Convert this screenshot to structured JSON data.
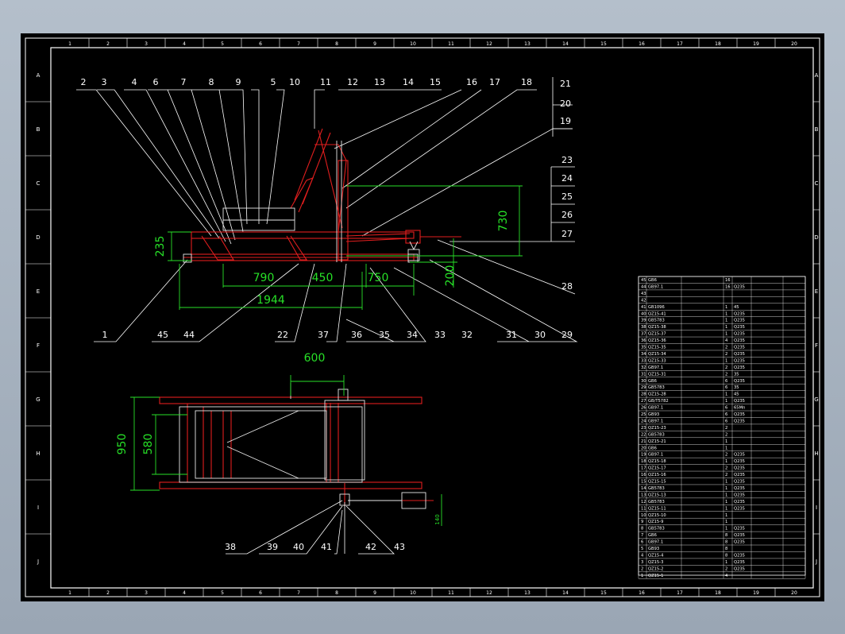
{
  "window": {
    "background_colors": [
      "#b4bfcb",
      "#9aa6b4"
    ],
    "canvas_color": "#000000"
  },
  "frame": {
    "columns": [
      "1",
      "2",
      "3",
      "4",
      "5",
      "6",
      "7",
      "8",
      "9",
      "10",
      "11",
      "12",
      "13",
      "14",
      "15",
      "16",
      "17",
      "18",
      "19",
      "20"
    ],
    "rows": [
      "A",
      "B",
      "C",
      "D",
      "E",
      "F",
      "G",
      "H",
      "I",
      "J"
    ],
    "line_color": "#ffffff"
  },
  "side_view": {
    "callouts_top": [
      "2",
      "3",
      "4",
      "6",
      "7",
      "8",
      "9",
      "5",
      "10",
      "11",
      "12",
      "13",
      "14",
      "15",
      "16",
      "17",
      "18",
      "21",
      "20",
      "19"
    ],
    "callouts_right": [
      "23",
      "24",
      "25",
      "26",
      "27",
      "28"
    ],
    "callouts_bottom": [
      "1",
      "45",
      "44",
      "22",
      "37",
      "36",
      "35",
      "34",
      "33",
      "32",
      "31",
      "30",
      "29"
    ],
    "dimensions": [
      "235",
      "790",
      "450",
      "750",
      "1944",
      "730",
      "200"
    ]
  },
  "top_view": {
    "dimensions": [
      "600",
      "950",
      "580",
      "140"
    ],
    "callouts": [
      "38",
      "39",
      "40",
      "41",
      "42",
      "43"
    ]
  },
  "parts_list": {
    "rows": [
      [
        "45",
        "GB6",
        "",
        "16",
        ""
      ],
      [
        "44",
        "GB97.1",
        "",
        "16",
        "Q235"
      ],
      [
        "43",
        "",
        "",
        "",
        ""
      ],
      [
        "42",
        "",
        "",
        "",
        ""
      ],
      [
        "41",
        "GB1096",
        "",
        "1",
        "45"
      ],
      [
        "40",
        "QZ15-41",
        "",
        "1",
        "Q235"
      ],
      [
        "39",
        "GB5783",
        "",
        "1",
        "Q235"
      ],
      [
        "38",
        "QZ15-38",
        "",
        "1",
        "Q235"
      ],
      [
        "37",
        "QZ15-37",
        "",
        "1",
        "Q235"
      ],
      [
        "36",
        "QZ15-36",
        "",
        "4",
        "Q235"
      ],
      [
        "35",
        "QZ15-35",
        "",
        "2",
        "Q235"
      ],
      [
        "34",
        "QZ15-34",
        "",
        "2",
        "Q235"
      ],
      [
        "33",
        "QZ15-33",
        "",
        "1",
        "Q235"
      ],
      [
        "32",
        "GB97.1",
        "",
        "2",
        "Q235"
      ],
      [
        "31",
        "QZ15-31",
        "",
        "2",
        "35"
      ],
      [
        "30",
        "GB6",
        "",
        "6",
        "Q235"
      ],
      [
        "29",
        "GB5783",
        "",
        "6",
        "35"
      ],
      [
        "28",
        "QZ15-28",
        "",
        "1",
        "45"
      ],
      [
        "27",
        "GB/T5782",
        "",
        "1",
        "Q235"
      ],
      [
        "26",
        "GB97.1",
        "",
        "6",
        "65Mn"
      ],
      [
        "25",
        "GB93",
        "",
        "6",
        "Q235"
      ],
      [
        "24",
        "GB97.1",
        "",
        "6",
        "Q235"
      ],
      [
        "23",
        "QZ15-23",
        "",
        "2",
        ""
      ],
      [
        "22",
        "GB5783",
        "",
        "2",
        ""
      ],
      [
        "21",
        "QZ15-21",
        "",
        "1",
        ""
      ],
      [
        "20",
        "GB6",
        "",
        "1",
        ""
      ],
      [
        "19",
        "GB97.1",
        "",
        "2",
        "Q235"
      ],
      [
        "18",
        "QZ15-18",
        "",
        "1",
        "Q235"
      ],
      [
        "17",
        "QZ15-17",
        "",
        "2",
        "Q235"
      ],
      [
        "16",
        "QZ15-16",
        "",
        "2",
        "Q235"
      ],
      [
        "15",
        "QZ15-15",
        "",
        "1",
        "Q235"
      ],
      [
        "14",
        "GB5783",
        "",
        "1",
        "Q235"
      ],
      [
        "13",
        "QZ15-13",
        "",
        "1",
        "Q235"
      ],
      [
        "12",
        "GB5783",
        "",
        "1",
        "Q235"
      ],
      [
        "11",
        "QZ15-11",
        "",
        "1",
        "Q235"
      ],
      [
        "10",
        "QZ15-10",
        "",
        "1",
        ""
      ],
      [
        "9",
        "QZ15-9",
        "",
        "1",
        ""
      ],
      [
        "8",
        "GB5783",
        "",
        "1",
        "Q235"
      ],
      [
        "7",
        "GB6",
        "",
        "8",
        "Q235"
      ],
      [
        "6",
        "GB97.1",
        "",
        "8",
        "Q235"
      ],
      [
        "5",
        "GB93",
        "",
        "8",
        ""
      ],
      [
        "4",
        "QZ15-4",
        "",
        "8",
        "Q235"
      ],
      [
        "3",
        "QZ15-3",
        "",
        "1",
        "Q235"
      ],
      [
        "2",
        "QZ15-2",
        "",
        "2",
        "Q235"
      ],
      [
        "1",
        "QZ15-1",
        "",
        "4",
        ""
      ]
    ]
  }
}
